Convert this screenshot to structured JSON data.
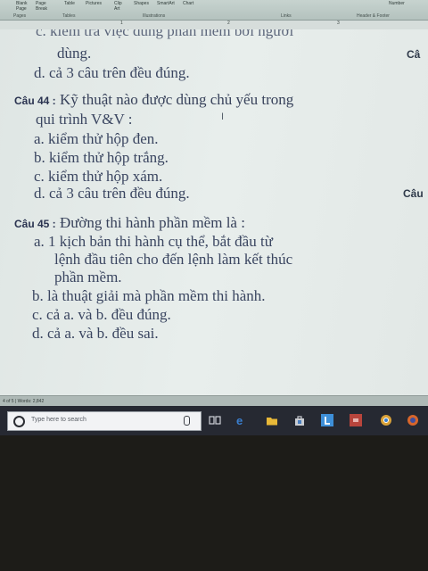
{
  "ribbon": {
    "buttons": [
      "Blank\nPage",
      "Page\nBreak",
      "Table",
      "Pictures",
      "Clip\nArt",
      "Shapes",
      "SmartArt",
      "Chart",
      "Number"
    ],
    "groups": [
      "Pages",
      "Tables",
      "Illustrations",
      "Links",
      "Header & Footer"
    ]
  },
  "ruler": {
    "numbers": [
      "1",
      "2",
      "3"
    ]
  },
  "document": {
    "prev_option_c": "c. kiểm tra việc dùng phần mềm bởi người",
    "prev_option_c_cont": "dùng.",
    "prev_option_d": "d. cả 3 câu trên đều đúng.",
    "q44": {
      "label": "Câu 44 :",
      "text": "Kỹ thuật nào được dùng chủ yếu trong",
      "text_cont": "qui trình V&V :",
      "options": [
        "a. kiểm thử hộp đen.",
        "b. kiểm thử hộp trắng.",
        "c. kiểm thử hộp xám.",
        "d. cả 3 câu trên đều đúng."
      ]
    },
    "q45": {
      "label": "Câu 45 :",
      "text": "Đường thi hành phần mềm là :",
      "option_a_lines": [
        "a. 1 kịch bản thi hành cụ thể, bắt đầu từ",
        "lệnh đầu tiên cho đến lệnh làm kết thúc",
        "phần mềm."
      ],
      "options": [
        "b. là thuật giải mà phần mềm thi hành.",
        "c. cả a. và b. đều đúng.",
        "d. cả a. và b. đều sai."
      ]
    },
    "side_labels": [
      "Câ",
      "Câu"
    ],
    "cursor": "I"
  },
  "statusbar": {
    "text": "4 of 5 | Words: 2,842"
  },
  "taskbar": {
    "search_placeholder": "Type here to search",
    "apps": [
      {
        "icon": "task-view-icon",
        "color": "#d0d3d8"
      },
      {
        "icon": "edge-icon",
        "color": "#3a7fd0"
      },
      {
        "icon": "file-explorer-icon",
        "color": "#e8b838"
      },
      {
        "icon": "store-icon",
        "color": "#c9ccd2"
      },
      {
        "icon": "l-app-icon",
        "color": "#3e8fd8"
      },
      {
        "icon": "red-app-icon",
        "color": "#b8453c"
      },
      {
        "icon": "chrome-icon",
        "color": "#d9a23a"
      },
      {
        "icon": "firefox-icon",
        "color": "#d7662c"
      }
    ]
  }
}
